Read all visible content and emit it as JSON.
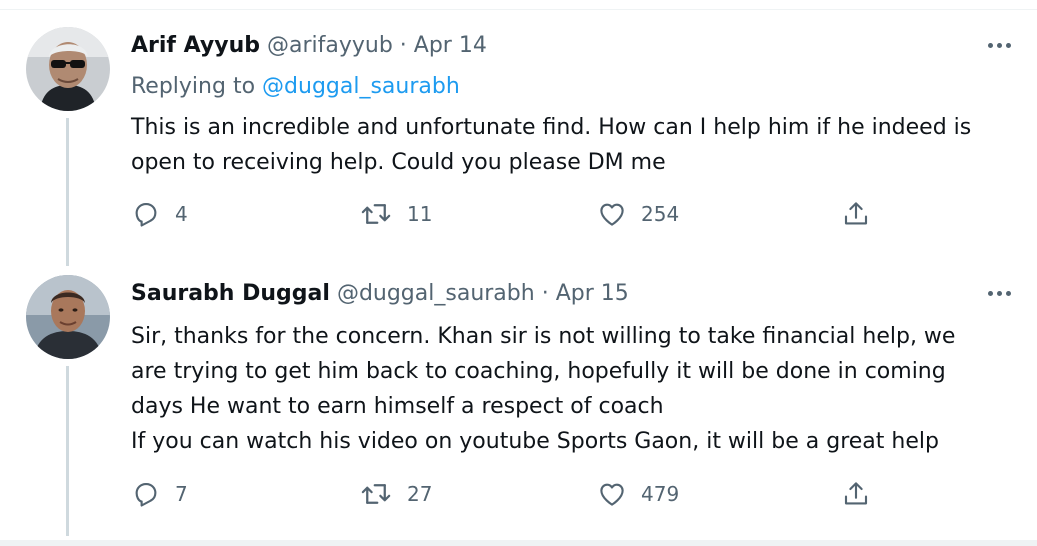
{
  "tweets": [
    {
      "name": "Arif Ayyub",
      "handle": "@arifayyub",
      "date": "· Apr 14",
      "replying_prefix": "Replying to",
      "replying_to": "@duggal_saurabh",
      "text_lines": [
        "This is an incredible and unfortunate find. How can I help him if he indeed is",
        "open to receiving help. Could you please DM me"
      ],
      "replies": "4",
      "retweets": "11",
      "likes": "254"
    },
    {
      "name": "Saurabh Duggal",
      "handle": "@duggal_saurabh",
      "date": "· Apr 15",
      "text_lines": [
        "Sir, thanks for the concern. Khan sir is not willing to take financial help, we",
        "are trying to get him back to coaching, hopefully it will be done in coming",
        "days He want to earn himself a respect of coach",
        "If you can watch his video on youtube Sports Gaon, it will be a great help"
      ],
      "replies": "7",
      "retweets": "27",
      "likes": "479"
    }
  ],
  "icons": {
    "reply": "reply-icon",
    "retweet": "retweet-icon",
    "like": "heart-icon",
    "share": "share-icon",
    "more": "more-icon"
  },
  "colors": {
    "text": "#0f1419",
    "muted": "#536471",
    "link": "#1d9bf0",
    "thread_line": "#cfd9de"
  }
}
